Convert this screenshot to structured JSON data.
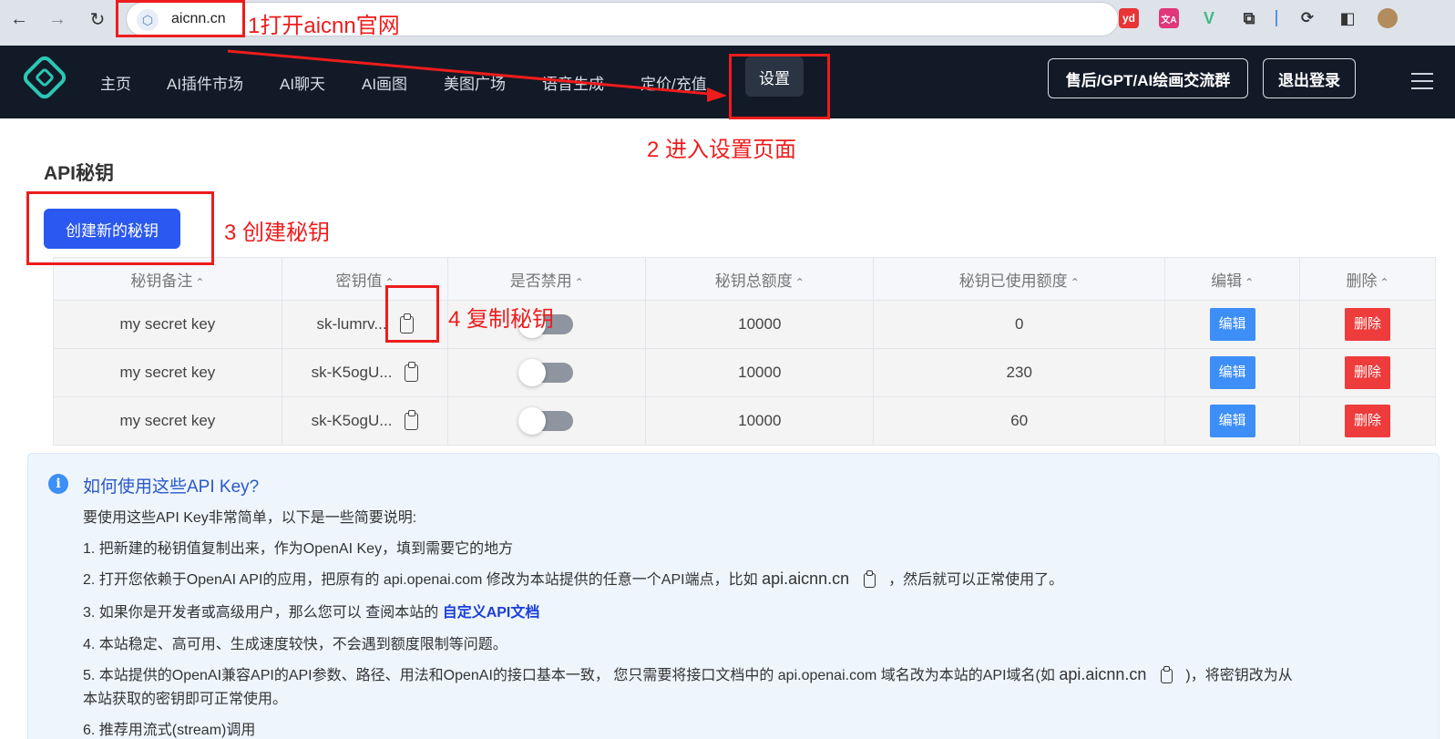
{
  "browser": {
    "url": "aicnn.cn",
    "extensions": [
      {
        "name": "youdao-extension-icon",
        "label": "yd",
        "color": "#e83434"
      },
      {
        "name": "translate-extension-icon",
        "label": "文A",
        "color": "#e0377a"
      },
      {
        "name": "vue-devtools-icon",
        "label": "V",
        "color": "#41b883"
      }
    ]
  },
  "header": {
    "nav": [
      "主页",
      "AI插件市场",
      "AI聊天",
      "AI画图",
      "美图广场",
      "语音生成",
      "定价/充值",
      "设置"
    ],
    "group_button": "售后/GPT/AI绘画交流群",
    "logout_button": "退出登录"
  },
  "section_title": "API秘钥",
  "create_button": "创建新的秘钥",
  "table": {
    "columns": [
      "秘钥备注",
      "密钥值",
      "是否禁用",
      "秘钥总额度",
      "秘钥已使用额度",
      "编辑",
      "删除"
    ],
    "rows": [
      {
        "note": "my secret key",
        "key": "sk-lumrv...",
        "disabled": false,
        "total": "10000",
        "used": "0",
        "edit": "编辑",
        "delete": "删除"
      },
      {
        "note": "my secret key",
        "key": "sk-K5ogU...",
        "disabled": false,
        "total": "10000",
        "used": "230",
        "edit": "编辑",
        "delete": "删除"
      },
      {
        "note": "my secret key",
        "key": "sk-K5ogU...",
        "disabled": false,
        "total": "10000",
        "used": "60",
        "edit": "编辑",
        "delete": "删除"
      }
    ]
  },
  "info": {
    "title": "如何使用这些API Key?",
    "intro": "要使用这些API Key非常简单，以下是一些简要说明:",
    "line1": "1. 把新建的秘钥值复制出来，作为OpenAI Key，填到需要它的地方",
    "line2_a": "2. 打开您依赖于OpenAI API的应用，把原有的 api.openai.com 修改为本站提供的任意一个API端点，比如",
    "line2_domain": "api.aicnn.cn",
    "line2_b": "，然后就可以正常使用了。",
    "line3_a": "3. 如果你是开发者或高级用户，那么您可以 查阅本站的",
    "line3_link": "自定义API文档",
    "line4": "4. 本站稳定、高可用、生成速度较快，不会遇到额度限制等问题。",
    "line5_a": "5. 本站提供的OpenAI兼容API的API参数、路径、用法和OpenAI的接口基本一致， 您只需要将接口文档中的 api.openai.com 域名改为本站的API域名(如",
    "line5_domain": "api.aicnn.cn",
    "line5_b": ")，将密钥改为从",
    "line5_c": "本站获取的密钥即可正常使用。",
    "line6": "6. 推荐用流式(stream)调用"
  },
  "annotations": {
    "step1": "1打开aicnn官网",
    "step2": "2 进入设置页面",
    "step3": "3 创建秘钥",
    "step4": "4 复制秘钥",
    "color": "#ee1c1c"
  }
}
